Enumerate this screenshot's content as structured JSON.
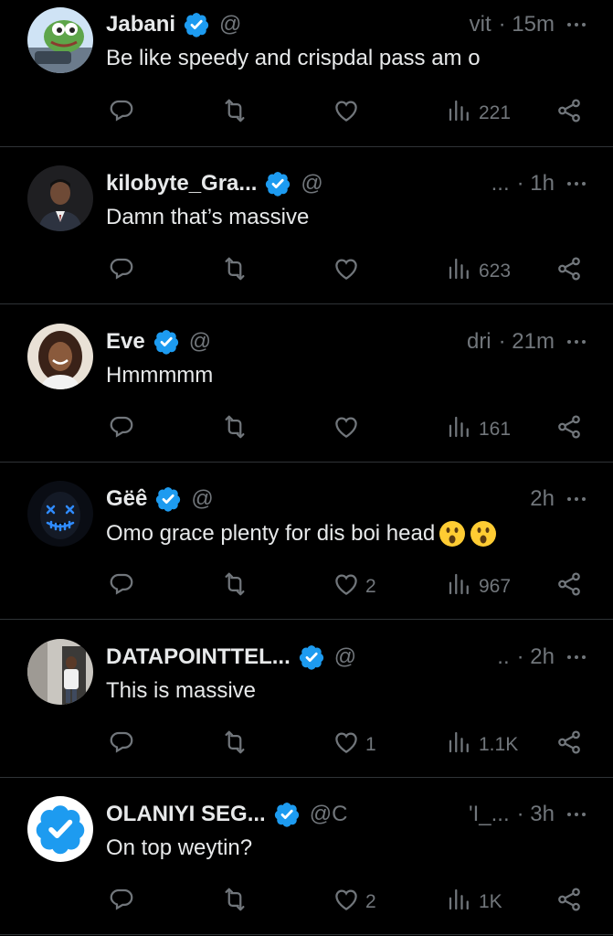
{
  "tweets": [
    {
      "name": "Jabani",
      "handle": "@",
      "handle_tail": "vit",
      "time": "· 15m",
      "text": "Be like speedy and crispdal pass am o",
      "likes": "",
      "views": "221",
      "avatar_style": "frog"
    },
    {
      "name": "kilobyte_Gra...",
      "handle": "@",
      "handle_tail": "...",
      "time": "· 1h",
      "text": "Damn that’s massive",
      "likes": "",
      "views": "623",
      "avatar_style": "man-suit"
    },
    {
      "name": "Eve",
      "handle": "@",
      "handle_tail": "dri",
      "time": "· 21m",
      "text": "Hmmmmm",
      "likes": "",
      "views": "161",
      "avatar_style": "woman"
    },
    {
      "name": "Gëê",
      "handle": "@",
      "handle_tail": "",
      "time": "2h",
      "text": "Omo grace plenty for dis boi head",
      "emoji_count": 2,
      "likes": "",
      "views": "967",
      "avatar_style": "neon-mask"
    },
    {
      "name": "DATAPOINTTEL...",
      "handle": "@",
      "handle_tail": "..",
      "time": "· 2h",
      "text": "This is massive",
      "likes": "1",
      "views": "1.1K",
      "avatar_style": "man-white"
    },
    {
      "name": "OLANIYI SEG...",
      "handle": "@C",
      "handle_tail": "'I_...",
      "time": "· 3h",
      "text": "On top weytin?",
      "likes": "2",
      "views": "1K",
      "avatar_style": "verified-badge"
    }
  ],
  "tweet_4_likes": "2",
  "colors": {
    "background": "#000000",
    "text": "#e7e9ea",
    "muted": "#71767b",
    "verified": "#1d9bf0",
    "divider": "#2f3336"
  },
  "icons": [
    "reply-icon",
    "retweet-icon",
    "like-icon",
    "views-icon",
    "share-icon",
    "more-icon",
    "verified-icon"
  ]
}
